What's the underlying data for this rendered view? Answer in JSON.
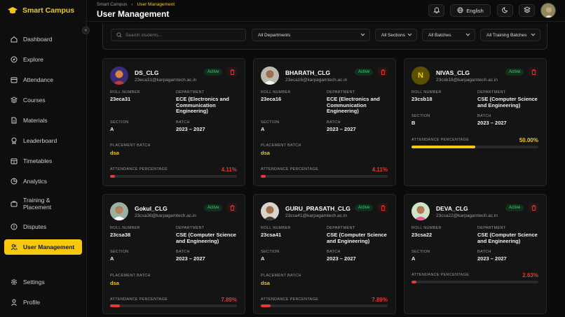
{
  "app": {
    "name": "Smart Campus"
  },
  "breadcrumb": {
    "root": "Smart Campus",
    "current": "User Management"
  },
  "page_title": "User Management",
  "header": {
    "language": "English"
  },
  "sidebar": {
    "items": [
      {
        "label": "Dashboard",
        "icon": "home-icon"
      },
      {
        "label": "Explore",
        "icon": "compass-icon"
      },
      {
        "label": "Attendance",
        "icon": "calendar-icon"
      },
      {
        "label": "Courses",
        "icon": "layers-icon"
      },
      {
        "label": "Materials",
        "icon": "document-icon"
      },
      {
        "label": "Leaderboard",
        "icon": "trophy-icon"
      },
      {
        "label": "Timetables",
        "icon": "calendar-grid-icon"
      },
      {
        "label": "Analytics",
        "icon": "pie-chart-icon"
      },
      {
        "label": "Training & Placement",
        "icon": "briefcase-icon"
      },
      {
        "label": "Disputes",
        "icon": "alert-circle-icon"
      },
      {
        "label": "User Management",
        "icon": "users-icon",
        "active": true
      },
      {
        "label": "Settings",
        "icon": "gear-icon"
      },
      {
        "label": "Profile",
        "icon": "user-icon"
      }
    ]
  },
  "filters": {
    "search_placeholder": "Search students...",
    "department": "All Departments",
    "section": "All Sections",
    "batch": "All Batches",
    "training_batch": "All Training Batches"
  },
  "labels": {
    "roll_number": "ROLL NUMBER",
    "department": "DEPARTMENT",
    "section": "SECTION",
    "batch": "BATCH",
    "placement_batch": "PLACEMENT BATCH",
    "attendance": "ATTENDANCE PERCENTAGE"
  },
  "colors": {
    "accent": "#f6c90e",
    "danger": "#e53935",
    "success": "#37d474",
    "warning": "#f6c90e"
  },
  "students": [
    {
      "name": "DS_CLG",
      "email": "23eca31@karpagamtech.ac.in",
      "status": "Active",
      "roll": "23eca31",
      "department": "ECE (Electronics and Communication Engineering)",
      "section": "A",
      "batch": "2023 – 2027",
      "placement_batch": "dsa",
      "attendance": "4.11%",
      "attendance_value": 4.11,
      "bar_color": "#e53935"
    },
    {
      "name": "BHARATH_CLG",
      "email": "23eca16@karpagamtech.ac.in",
      "status": "Active",
      "roll": "23eca16",
      "department": "ECE (Electronics and Communication Engineering)",
      "section": "A",
      "batch": "2023 – 2027",
      "placement_batch": "dsa",
      "attendance": "4.11%",
      "attendance_value": 4.11,
      "bar_color": "#e53935"
    },
    {
      "name": "NIVAS_CLG",
      "email": "23csb18@karpagamtech.ac.in",
      "status": "Active",
      "roll": "23csb18",
      "department": "CSE (Computer Science and Engineering)",
      "section": "B",
      "batch": "2023 – 2027",
      "placement_batch": "",
      "attendance": "50.00%",
      "attendance_value": 50.0,
      "bar_color": "#f6c90e",
      "initial": "N"
    },
    {
      "name": "Gokul_CLG",
      "email": "23csa38@karpagamtech.ac.in",
      "status": "Active",
      "roll": "23csa38",
      "department": "CSE (Computer Science and Engineering)",
      "section": "A",
      "batch": "2023 – 2027",
      "placement_batch": "dsa",
      "attendance": "7.89%",
      "attendance_value": 7.89,
      "bar_color": "#e53935"
    },
    {
      "name": "GURU_PRASATH_CLG",
      "email": "23csa41@karpagamtech.ac.in",
      "status": "Active",
      "roll": "23csa41",
      "department": "CSE (Computer Science and Engineering)",
      "section": "A",
      "batch": "2023 – 2027",
      "placement_batch": "dsa",
      "attendance": "7.89%",
      "attendance_value": 7.89,
      "bar_color": "#e53935"
    },
    {
      "name": "DEVA_CLG",
      "email": "23csa22@karpagamtech.ac.in",
      "status": "Active",
      "roll": "23csa22",
      "department": "CSE (Computer Science and Engineering)",
      "section": "A",
      "batch": "2023 – 2027",
      "placement_batch": "",
      "attendance": "2.63%",
      "attendance_value": 2.63,
      "bar_color": "#e53935"
    }
  ]
}
